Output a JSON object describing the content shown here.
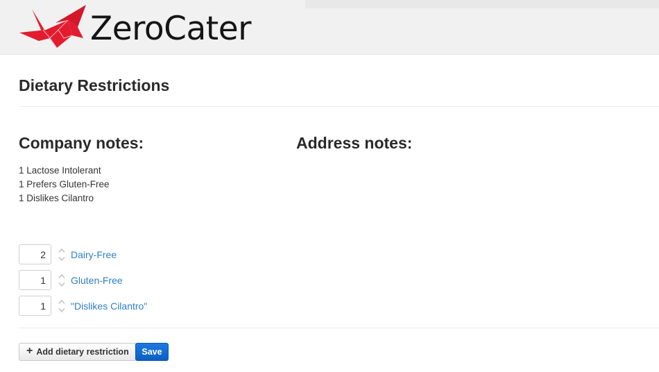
{
  "header": {
    "brand": "ZeroCater",
    "brand_color": "#e31b2e"
  },
  "page": {
    "title": "Dietary Restrictions"
  },
  "company_notes": {
    "title": "Company notes:",
    "items": [
      "1 Lactose Intolerant",
      "1 Prefers Gluten-Free",
      "1 Dislikes Cilantro"
    ]
  },
  "address_notes": {
    "title": "Address notes:"
  },
  "restrictions": [
    {
      "quantity": "2",
      "label": "Dairy-Free"
    },
    {
      "quantity": "1",
      "label": "Gluten-Free"
    },
    {
      "quantity": "1",
      "label": "\"Dislikes Cilantro\""
    }
  ],
  "actions": {
    "add_label": "Add dietary restriction",
    "add_icon": "plus-icon",
    "save_label": "Save",
    "save_color": "#1166cc",
    "link_color": "#2f7fc1"
  }
}
